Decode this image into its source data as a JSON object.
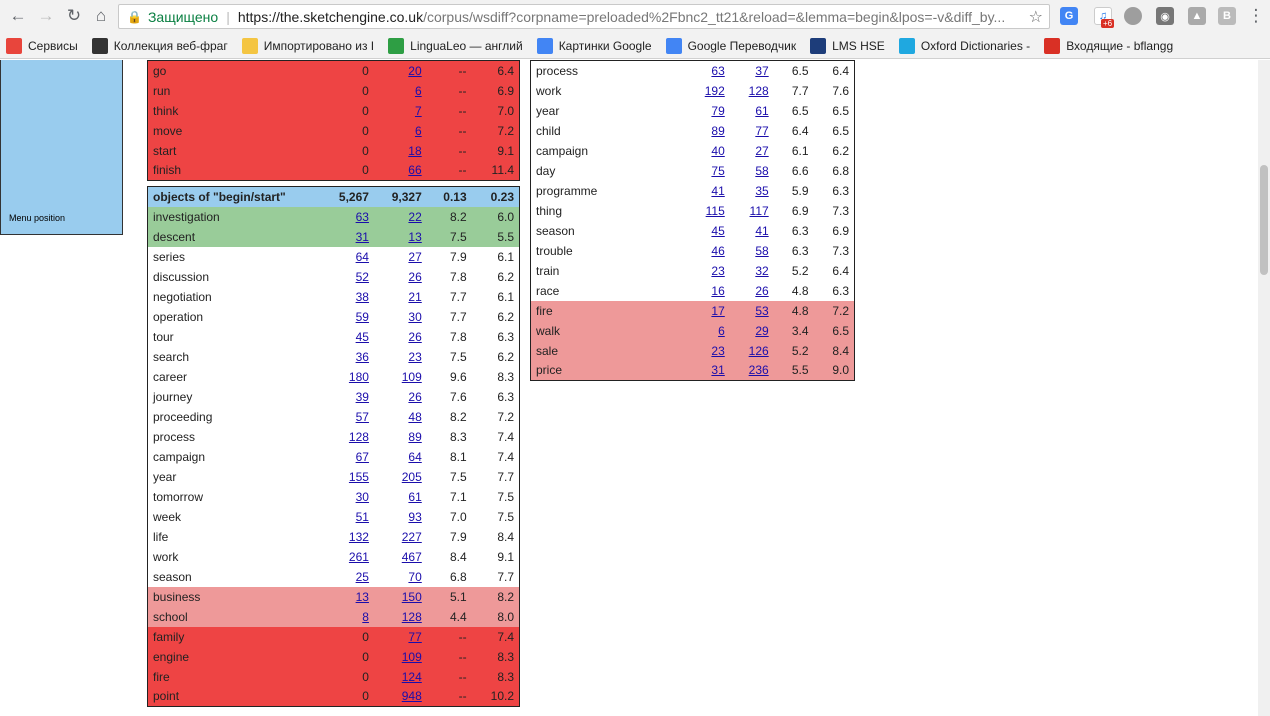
{
  "browser": {
    "secure_label": "Защищено",
    "url_host": "https://the.sketchengine.co.uk",
    "url_path": "/corpus/wsdiff?corpname=preloaded%2Fbnc2_tt21&reload=&lemma=begin&lpos=-v&diff_by...",
    "ext_badge": "+6"
  },
  "bookmarks": [
    {
      "label": "Сервисы",
      "icon": "apps-grid-icon",
      "color": "#e8453c"
    },
    {
      "label": "Коллекция веб-фраг",
      "icon": "web-slice-icon",
      "color": "#333333"
    },
    {
      "label": "Импортировано из I",
      "icon": "folder-icon",
      "color": "#f4c542"
    },
    {
      "label": "LinguaLeo — англий",
      "icon": "lingualeo-icon",
      "color": "#2e9e44"
    },
    {
      "label": "Картинки Google",
      "icon": "google-icon",
      "color": "#4285f4"
    },
    {
      "label": "Google Переводчик",
      "icon": "google-translate-icon",
      "color": "#4285f4"
    },
    {
      "label": "LMS HSE",
      "icon": "lms-icon",
      "color": "#1d3d7a"
    },
    {
      "label": "Oxford Dictionaries -",
      "icon": "oxford-icon",
      "color": "#1fa8e0"
    },
    {
      "label": "Входящие - bflangg",
      "icon": "gmail-icon",
      "color": "#d93025"
    }
  ],
  "menu": {
    "position_label": "Menu position"
  },
  "top_table": {
    "rows": [
      {
        "w": "go",
        "c1": "0",
        "c2": "20",
        "s1": "--",
        "s2": "6.4",
        "style": "red",
        "c1_link": false
      },
      {
        "w": "run",
        "c1": "0",
        "c2": "6",
        "s1": "--",
        "s2": "6.9",
        "style": "red",
        "c1_link": false
      },
      {
        "w": "think",
        "c1": "0",
        "c2": "7",
        "s1": "--",
        "s2": "7.0",
        "style": "red",
        "c1_link": false
      },
      {
        "w": "move",
        "c1": "0",
        "c2": "6",
        "s1": "--",
        "s2": "7.2",
        "style": "red",
        "c1_link": false
      },
      {
        "w": "start",
        "c1": "0",
        "c2": "18",
        "s1": "--",
        "s2": "9.1",
        "style": "red",
        "c1_link": false
      },
      {
        "w": "finish",
        "c1": "0",
        "c2": "66",
        "s1": "--",
        "s2": "11.4",
        "style": "red",
        "c1_link": false
      }
    ]
  },
  "objects_table": {
    "header": {
      "title": "objects of \"begin/start\"",
      "f1": "5,267",
      "f2": "9,327",
      "s1": "0.13",
      "s2": "0.23"
    },
    "rows": [
      {
        "w": "investigation",
        "c1": "63",
        "c2": "22",
        "s1": "8.2",
        "s2": "6.0",
        "style": "green",
        "c1_link": true
      },
      {
        "w": "descent",
        "c1": "31",
        "c2": "13",
        "s1": "7.5",
        "s2": "5.5",
        "style": "green",
        "c1_link": true
      },
      {
        "w": "series",
        "c1": "64",
        "c2": "27",
        "s1": "7.9",
        "s2": "6.1",
        "style": "white",
        "c1_link": true
      },
      {
        "w": "discussion",
        "c1": "52",
        "c2": "26",
        "s1": "7.8",
        "s2": "6.2",
        "style": "white",
        "c1_link": true
      },
      {
        "w": "negotiation",
        "c1": "38",
        "c2": "21",
        "s1": "7.7",
        "s2": "6.1",
        "style": "white",
        "c1_link": true
      },
      {
        "w": "operation",
        "c1": "59",
        "c2": "30",
        "s1": "7.7",
        "s2": "6.2",
        "style": "white",
        "c1_link": true
      },
      {
        "w": "tour",
        "c1": "45",
        "c2": "26",
        "s1": "7.8",
        "s2": "6.3",
        "style": "white",
        "c1_link": true
      },
      {
        "w": "search",
        "c1": "36",
        "c2": "23",
        "s1": "7.5",
        "s2": "6.2",
        "style": "white",
        "c1_link": true
      },
      {
        "w": "career",
        "c1": "180",
        "c2": "109",
        "s1": "9.6",
        "s2": "8.3",
        "style": "white",
        "c1_link": true
      },
      {
        "w": "journey",
        "c1": "39",
        "c2": "26",
        "s1": "7.6",
        "s2": "6.3",
        "style": "white",
        "c1_link": true
      },
      {
        "w": "proceeding",
        "c1": "57",
        "c2": "48",
        "s1": "8.2",
        "s2": "7.2",
        "style": "white",
        "c1_link": true
      },
      {
        "w": "process",
        "c1": "128",
        "c2": "89",
        "s1": "8.3",
        "s2": "7.4",
        "style": "white",
        "c1_link": true
      },
      {
        "w": "campaign",
        "c1": "67",
        "c2": "64",
        "s1": "8.1",
        "s2": "7.4",
        "style": "white",
        "c1_link": true
      },
      {
        "w": "year",
        "c1": "155",
        "c2": "205",
        "s1": "7.5",
        "s2": "7.7",
        "style": "white",
        "c1_link": true
      },
      {
        "w": "tomorrow",
        "c1": "30",
        "c2": "61",
        "s1": "7.1",
        "s2": "7.5",
        "style": "white",
        "c1_link": true
      },
      {
        "w": "week",
        "c1": "51",
        "c2": "93",
        "s1": "7.0",
        "s2": "7.5",
        "style": "white",
        "c1_link": true
      },
      {
        "w": "life",
        "c1": "132",
        "c2": "227",
        "s1": "7.9",
        "s2": "8.4",
        "style": "white",
        "c1_link": true
      },
      {
        "w": "work",
        "c1": "261",
        "c2": "467",
        "s1": "8.4",
        "s2": "9.1",
        "style": "white",
        "c1_link": true
      },
      {
        "w": "season",
        "c1": "25",
        "c2": "70",
        "s1": "6.8",
        "s2": "7.7",
        "style": "white",
        "c1_link": true
      },
      {
        "w": "business",
        "c1": "13",
        "c2": "150",
        "s1": "5.1",
        "s2": "8.2",
        "style": "pink",
        "c1_link": true
      },
      {
        "w": "school",
        "c1": "8",
        "c2": "128",
        "s1": "4.4",
        "s2": "8.0",
        "style": "pink",
        "c1_link": true
      },
      {
        "w": "family",
        "c1": "0",
        "c2": "77",
        "s1": "--",
        "s2": "7.4",
        "style": "red",
        "c1_link": false
      },
      {
        "w": "engine",
        "c1": "0",
        "c2": "109",
        "s1": "--",
        "s2": "8.3",
        "style": "red",
        "c1_link": false
      },
      {
        "w": "fire",
        "c1": "0",
        "c2": "124",
        "s1": "--",
        "s2": "8.3",
        "style": "red",
        "c1_link": false
      },
      {
        "w": "point",
        "c1": "0",
        "c2": "948",
        "s1": "--",
        "s2": "10.2",
        "style": "red",
        "c1_link": false
      }
    ]
  },
  "right_table": {
    "rows": [
      {
        "w": "process",
        "c1": "63",
        "c2": "37",
        "s1": "6.5",
        "s2": "6.4",
        "style": "white",
        "c1_link": true
      },
      {
        "w": "work",
        "c1": "192",
        "c2": "128",
        "s1": "7.7",
        "s2": "7.6",
        "style": "white",
        "c1_link": true
      },
      {
        "w": "year",
        "c1": "79",
        "c2": "61",
        "s1": "6.5",
        "s2": "6.5",
        "style": "white",
        "c1_link": true
      },
      {
        "w": "child",
        "c1": "89",
        "c2": "77",
        "s1": "6.4",
        "s2": "6.5",
        "style": "white",
        "c1_link": true
      },
      {
        "w": "campaign",
        "c1": "40",
        "c2": "27",
        "s1": "6.1",
        "s2": "6.2",
        "style": "white",
        "c1_link": true
      },
      {
        "w": "day",
        "c1": "75",
        "c2": "58",
        "s1": "6.6",
        "s2": "6.8",
        "style": "white",
        "c1_link": true
      },
      {
        "w": "programme",
        "c1": "41",
        "c2": "35",
        "s1": "5.9",
        "s2": "6.3",
        "style": "white",
        "c1_link": true
      },
      {
        "w": "thing",
        "c1": "115",
        "c2": "117",
        "s1": "6.9",
        "s2": "7.3",
        "style": "white",
        "c1_link": true
      },
      {
        "w": "season",
        "c1": "45",
        "c2": "41",
        "s1": "6.3",
        "s2": "6.9",
        "style": "white",
        "c1_link": true
      },
      {
        "w": "trouble",
        "c1": "46",
        "c2": "58",
        "s1": "6.3",
        "s2": "7.3",
        "style": "white",
        "c1_link": true
      },
      {
        "w": "train",
        "c1": "23",
        "c2": "32",
        "s1": "5.2",
        "s2": "6.4",
        "style": "white",
        "c1_link": true
      },
      {
        "w": "race",
        "c1": "16",
        "c2": "26",
        "s1": "4.8",
        "s2": "6.3",
        "style": "white",
        "c1_link": true
      },
      {
        "w": "fire",
        "c1": "17",
        "c2": "53",
        "s1": "4.8",
        "s2": "7.2",
        "style": "pink",
        "c1_link": true
      },
      {
        "w": "walk",
        "c1": "6",
        "c2": "29",
        "s1": "3.4",
        "s2": "6.5",
        "style": "pink",
        "c1_link": true
      },
      {
        "w": "sale",
        "c1": "23",
        "c2": "126",
        "s1": "5.2",
        "s2": "8.4",
        "style": "pink",
        "c1_link": true
      },
      {
        "w": "price",
        "c1": "31",
        "c2": "236",
        "s1": "5.5",
        "s2": "9.0",
        "style": "pink",
        "c1_link": true
      }
    ]
  }
}
